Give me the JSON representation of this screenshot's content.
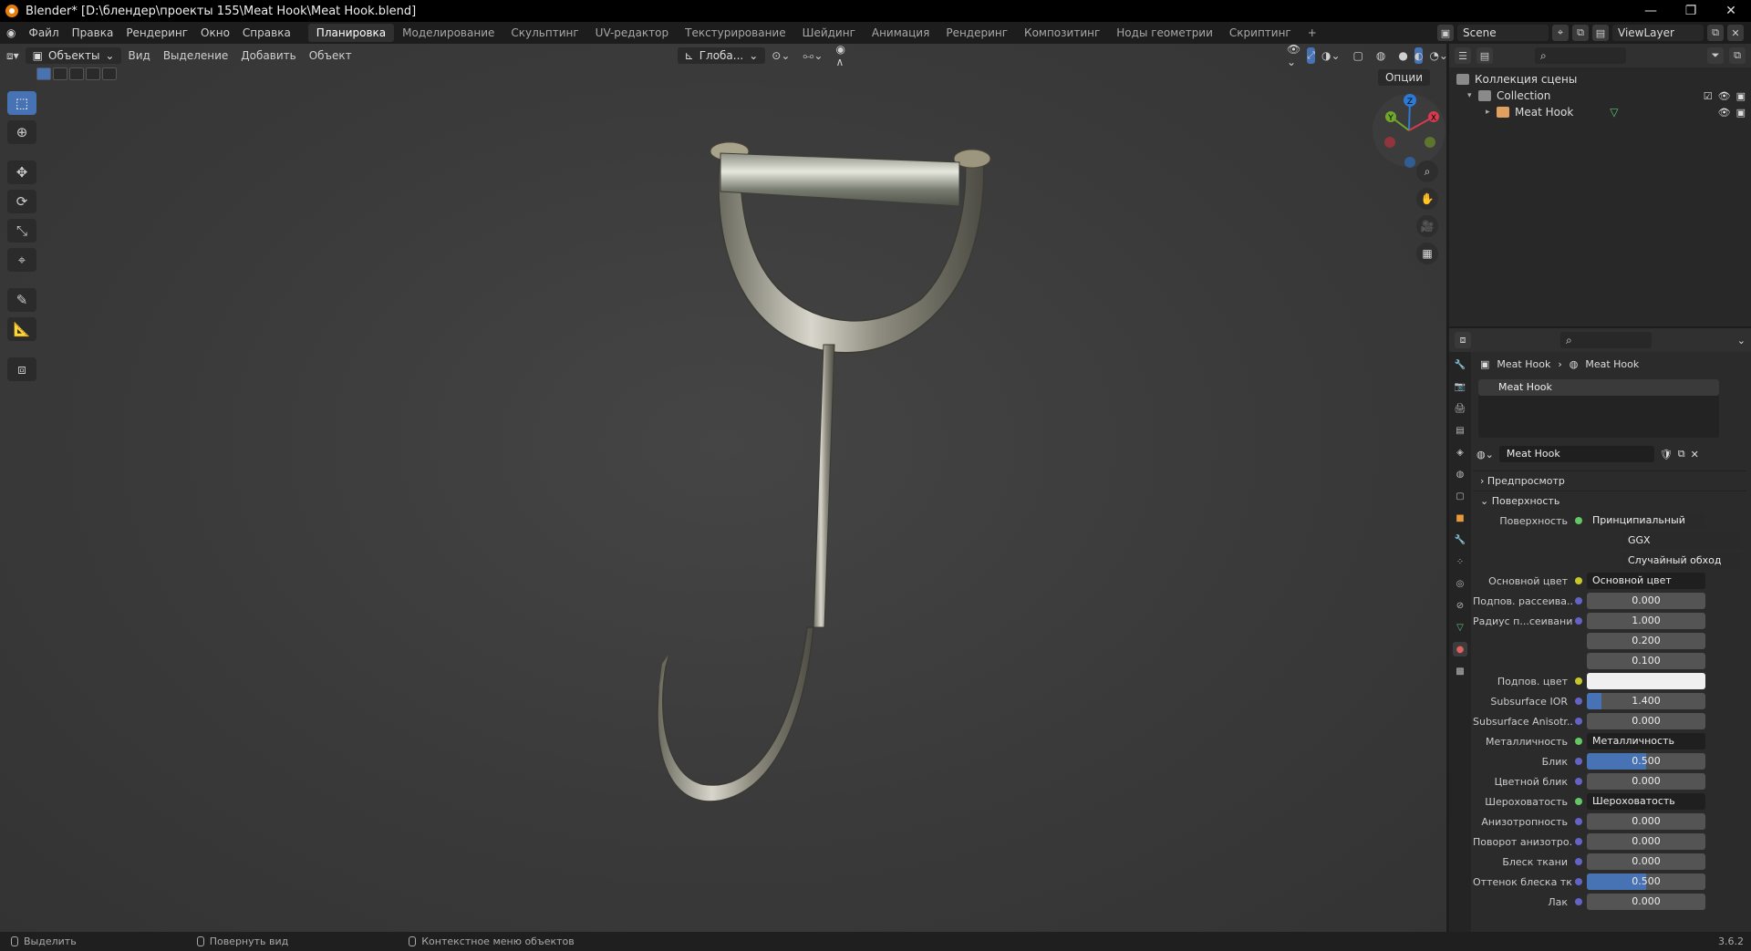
{
  "window": {
    "title": "Blender* [D:\\блендер\\проекты 155\\Meat Hook\\Meat Hook.blend]",
    "minimize": "—",
    "maximize": "❐",
    "close": "✕"
  },
  "menu": [
    "Файл",
    "Правка",
    "Рендеринг",
    "Окно",
    "Справка"
  ],
  "workspaces": [
    {
      "label": "Планировка",
      "active": true
    },
    {
      "label": "Моделирование"
    },
    {
      "label": "Скульптинг"
    },
    {
      "label": "UV-редактор"
    },
    {
      "label": "Текстурирование"
    },
    {
      "label": "Шейдинг"
    },
    {
      "label": "Анимация"
    },
    {
      "label": "Рендеринг"
    },
    {
      "label": "Композитинг"
    },
    {
      "label": "Ноды геометрии"
    },
    {
      "label": "Скриптинг"
    }
  ],
  "add_tab": "+",
  "scene": {
    "name": "Scene",
    "view_layer": "ViewLayer"
  },
  "viewport": {
    "mode": "Объекты",
    "menus": [
      "Вид",
      "Выделение",
      "Добавить",
      "Объект"
    ],
    "orientation": "Глоба...",
    "options": "Опции",
    "gizmo_axes": {
      "z": "Z",
      "y": "Y",
      "x": "X"
    }
  },
  "outliner": {
    "root": "Коллекция сцены",
    "collection": "Collection",
    "object": "Meat Hook"
  },
  "properties": {
    "breadcrumb": [
      "Meat Hook",
      "Meat Hook"
    ],
    "slot": "Meat Hook",
    "material": "Meat Hook",
    "panels": {
      "preview": "Предпросмотр",
      "surface": "Поверхность"
    },
    "surface_label": "Поверхность",
    "surface_value": "Принципиальный BSDF",
    "distribution": "GGX",
    "subsurface_method": "Случайный обход",
    "rows": [
      {
        "label": "Основной цвет",
        "value": "Основной цвет",
        "kind": "link",
        "dot": "y"
      },
      {
        "label": "Подпов. рассеива...",
        "value": "0.000",
        "kind": "num",
        "fill": 0
      },
      {
        "label": "Радиус п...сеивания",
        "value": "1.000",
        "kind": "num",
        "fill": 0
      },
      {
        "label": "",
        "value": "0.200",
        "kind": "num",
        "fill": 0
      },
      {
        "label": "",
        "value": "0.100",
        "kind": "num",
        "fill": 0
      },
      {
        "label": "Подпов. цвет",
        "value": "",
        "kind": "white",
        "dot": "y"
      },
      {
        "label": "Subsurface IOR",
        "value": "1.400",
        "kind": "num",
        "fill": 0.12
      },
      {
        "label": "Subsurface Anisotr...",
        "value": "0.000",
        "kind": "num",
        "fill": 0
      },
      {
        "label": "Металличность",
        "value": "Металличность",
        "kind": "link",
        "dot": "g"
      },
      {
        "label": "Блик",
        "value": "0.500",
        "kind": "num",
        "fill": 0.5
      },
      {
        "label": "Цветной блик",
        "value": "0.000",
        "kind": "num",
        "fill": 0
      },
      {
        "label": "Шероховатость",
        "value": "Шероховатость",
        "kind": "link",
        "dot": "g"
      },
      {
        "label": "Анизотропность",
        "value": "0.000",
        "kind": "num",
        "fill": 0
      },
      {
        "label": "Поворот анизотро...",
        "value": "0.000",
        "kind": "num",
        "fill": 0
      },
      {
        "label": "Блеск ткани",
        "value": "0.000",
        "kind": "num",
        "fill": 0
      },
      {
        "label": "Оттенок блеска тк...",
        "value": "0.500",
        "kind": "num",
        "fill": 0.5
      },
      {
        "label": "Лак",
        "value": "0.000",
        "kind": "num",
        "fill": 0
      }
    ]
  },
  "status": {
    "select": "Выделить",
    "rotate": "Повернуть вид",
    "context": "Контекстное меню объектов",
    "version": "3.6.2"
  }
}
